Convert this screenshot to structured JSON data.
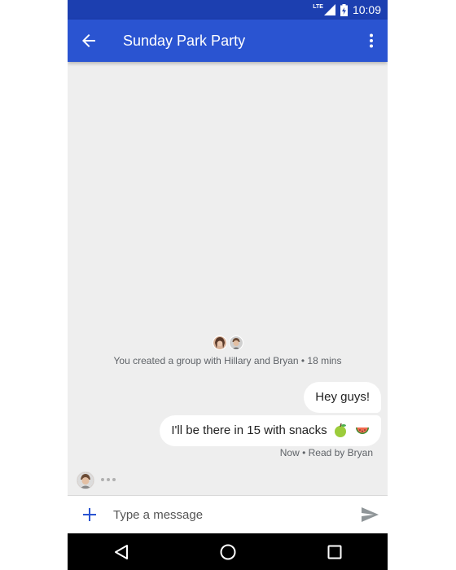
{
  "status_bar": {
    "network": "LTE",
    "time": "10:09"
  },
  "app_bar": {
    "title": "Sunday Park Party",
    "back_icon": "arrow-left-icon",
    "menu_icon": "more-vert-icon"
  },
  "conversation": {
    "system_message": "You created a group with Hillary and Bryan • 18 mins",
    "messages": [
      {
        "text": "Hey guys!"
      },
      {
        "text": "I'll be there in 15 with snacks",
        "emojis": [
          "green-apple-icon",
          "watermelon-icon"
        ]
      }
    ],
    "read_receipt": "Now • Read by Bryan"
  },
  "compose": {
    "placeholder": "Type a message",
    "add_icon": "plus-icon",
    "send_icon": "send-icon"
  },
  "colors": {
    "status_bar": "#1c3fb0",
    "app_bar": "#2a54d1",
    "background": "#eeeeee",
    "accent": "#2a54d1"
  }
}
